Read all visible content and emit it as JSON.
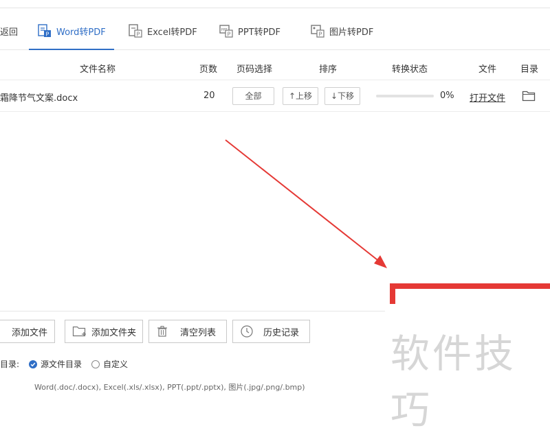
{
  "toolbar": {
    "back_label": "返回"
  },
  "tabs": [
    {
      "label": "Word转PDF",
      "icon": "word-pdf-icon",
      "active": true
    },
    {
      "label": "Excel转PDF",
      "icon": "excel-pdf-icon",
      "active": false
    },
    {
      "label": "PPT转PDF",
      "icon": "ppt-pdf-icon",
      "active": false
    },
    {
      "label": "图片转PDF",
      "icon": "image-pdf-icon",
      "active": false
    }
  ],
  "table": {
    "headers": {
      "name": "文件名称",
      "pages": "页数",
      "page_select": "页码选择",
      "order": "排序",
      "status": "转换状态",
      "file": "文件",
      "dir": "目录"
    },
    "rows": [
      {
        "file_name": "霜降节气文案.docx",
        "pages": "20",
        "page_select_label": "全部",
        "move_up_label": "↑上移",
        "move_down_label": "↓下移",
        "progress_text": "0%",
        "progress": 0,
        "open_file_label": "打开文件",
        "folder_icon": "folder-icon"
      }
    ]
  },
  "actions": {
    "add_file": "添加文件",
    "add_folder": "添加文件夹",
    "clear_list": "清空列表",
    "history": "历史记录"
  },
  "output_dir": {
    "label": "目录:",
    "source_dir": "源文件目录",
    "custom": "自定义",
    "selected": "source_dir"
  },
  "footnote": "Word(.doc/.docx), Excel(.xls/.xlsx), PPT(.ppt/.pptx), 图片(.jpg/.png/.bmp)",
  "watermark": "软件技巧",
  "colors": {
    "accent": "#2f6ec6",
    "arrow": "#e53935",
    "watermark": "#d6d6d6"
  }
}
